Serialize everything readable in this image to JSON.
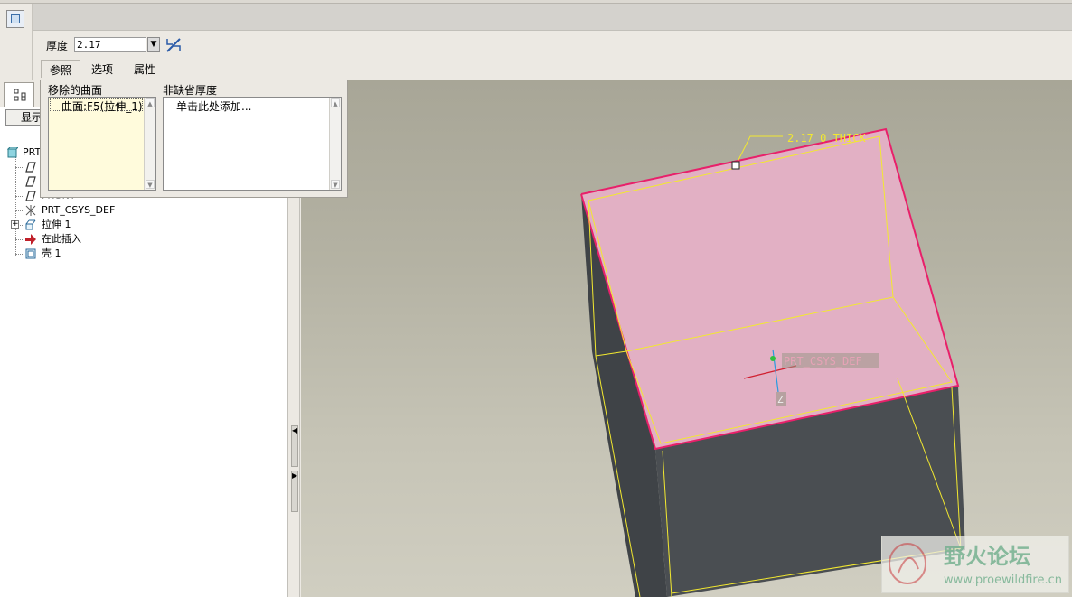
{
  "dashboard": {
    "thickness_label": "厚度",
    "thickness_value": "2.17",
    "tabs": [
      "参照",
      "选项",
      "属性"
    ],
    "active_tab": "参照"
  },
  "references_panel": {
    "removed_surfaces_label": "移除的曲面",
    "removed_surfaces": [
      "曲面:F5(拉伸_1)"
    ],
    "non_default_thickness_label": "非缺省厚度",
    "non_default_placeholder": "单击此处添加..."
  },
  "model_tree": {
    "show_button": "显示",
    "items": [
      {
        "label": "PRT",
        "icon": "part-icon"
      },
      {
        "label": "",
        "icon": "datum-plane-icon"
      },
      {
        "label": "",
        "icon": "datum-plane-icon"
      },
      {
        "label": "FRONT",
        "icon": "datum-plane-icon"
      },
      {
        "label": "PRT_CSYS_DEF",
        "icon": "csys-icon"
      },
      {
        "label": "拉伸 1",
        "icon": "extrude-icon"
      },
      {
        "label": "在此插入",
        "icon": "insert-here-arrow-icon"
      },
      {
        "label": "壳 1",
        "icon": "shell-icon"
      }
    ]
  },
  "viewport": {
    "dimension_label": "2.17 0_THICK",
    "csys_label": "PRT_CSYS_DEF",
    "axis_label": "Z",
    "colors": {
      "top_face": "#e2b0c4",
      "side_face": "#4a4e52",
      "edge_highlight": "#e8206a",
      "outline": "#f2e830"
    }
  },
  "watermark": {
    "brand": "野火论坛",
    "url": "www.proewildfire.cn"
  }
}
